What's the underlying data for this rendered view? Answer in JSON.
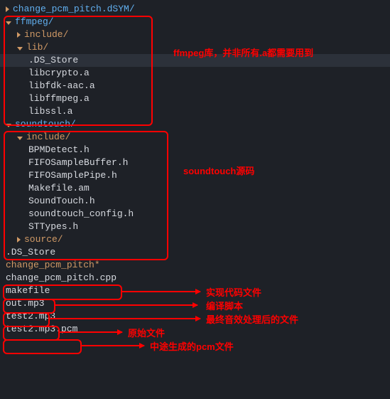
{
  "tree": {
    "root0": "change_pcm_pitch.dSYM/",
    "ffmpeg_dir": "ffmpeg/",
    "ffmpeg_include": "include/",
    "ffmpeg_lib": "lib/",
    "lib_files": [
      ".DS_Store",
      "libcrypto.a",
      "libfdk-aac.a",
      "libffmpeg.a",
      "libssl.a"
    ],
    "soundtouch_dir": "soundtouch/",
    "st_include": "include/",
    "st_headers": [
      "BPMDetect.h",
      "FIFOSampleBuffer.h",
      "FIFOSamplePipe.h",
      "Makefile.am",
      "SoundTouch.h",
      "soundtouch_config.h",
      "STTypes.h"
    ],
    "st_source": "source/",
    "dsstore": ".DS_Store",
    "exe": "change_pcm_pitch*",
    "cpp": "change_pcm_pitch.cpp",
    "makefile": "makefile",
    "outmp3": "out.mp3",
    "test2": "test2.mp3",
    "test2pcm": "test2.mp3.pcm"
  },
  "annotations": {
    "ffmpeg": "ffmpeg库，并非所有.a都需要用到",
    "soundtouch": "soundtouch源码",
    "cpp": "实现代码文件",
    "makefile": "编译脚本",
    "outmp3": "最终音效处理后的文件",
    "test2": "原始文件",
    "test2pcm": "中途生成的pcm文件"
  }
}
